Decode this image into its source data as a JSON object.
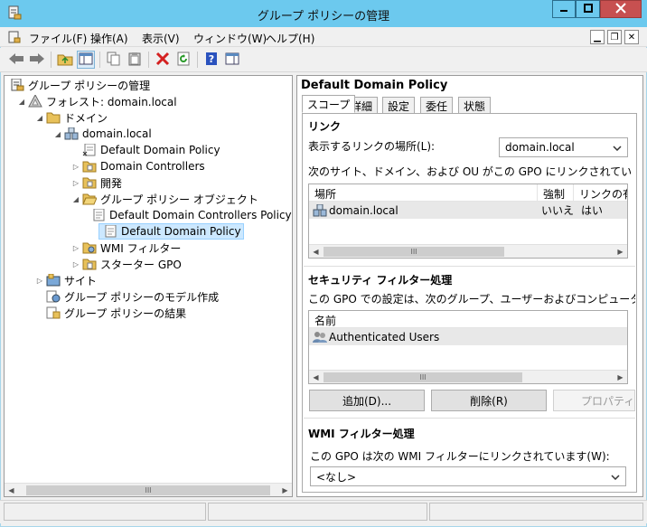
{
  "window": {
    "title": "グループ ポリシーの管理"
  },
  "menu": {
    "items": [
      "ファイル(F)",
      "操作(A)",
      "表示(V)",
      "ウィンドウ(W)",
      "ヘルプ(H)"
    ]
  },
  "tree": {
    "root": "グループ ポリシーの管理",
    "forest": "フォレスト: domain.local",
    "domains": "ドメイン",
    "domain": "domain.local",
    "ddp_link": "Default Domain Policy",
    "dc_ou": "Domain Controllers",
    "dev_ou": "開発",
    "gpo_container": "グループ ポリシー オブジェクト",
    "gpo_ddcp": "Default Domain Controllers Policy",
    "gpo_ddp": "Default Domain Policy",
    "wmi": "WMI フィルター",
    "starter": "スターター GPO",
    "sites": "サイト",
    "modeling": "グループ ポリシーのモデル作成",
    "results": "グループ ポリシーの結果"
  },
  "detail": {
    "title": "Default Domain Policy",
    "tabs": [
      "スコープ",
      "詳細",
      "設定",
      "委任",
      "状態"
    ],
    "links_heading": "リンク",
    "location_label": "表示するリンクの場所(L):",
    "location_value": "domain.local",
    "linked_desc": "次のサイト、ドメイン、および OU がこの GPO にリンクされています(T):",
    "links_table": {
      "headers": [
        "場所",
        "強制",
        "リンクの有効"
      ],
      "rows": [
        {
          "location": "domain.local",
          "enforced": "いいえ",
          "enabled": "はい"
        }
      ]
    },
    "security_heading": "セキュリティ フィルター処理",
    "security_desc": "この GPO での設定は、次のグループ、ユーザーおよびコンピューターにのみ適",
    "security_table": {
      "headers": [
        "名前"
      ],
      "rows": [
        {
          "name": "Authenticated Users"
        }
      ]
    },
    "buttons": {
      "add": "追加(D)...",
      "remove": "削除(R)",
      "properties": "プロパティ(P"
    },
    "wmi_heading": "WMI フィルター処理",
    "wmi_desc": "この GPO は次の WMI フィルターにリンクされています(W):",
    "wmi_value": "<なし>"
  },
  "scroll": {
    "thumb_glyph": "III"
  },
  "colors": {
    "titlebar": "#6cc9ee",
    "close_button": "#c75050",
    "selection": "#cce8ff"
  }
}
